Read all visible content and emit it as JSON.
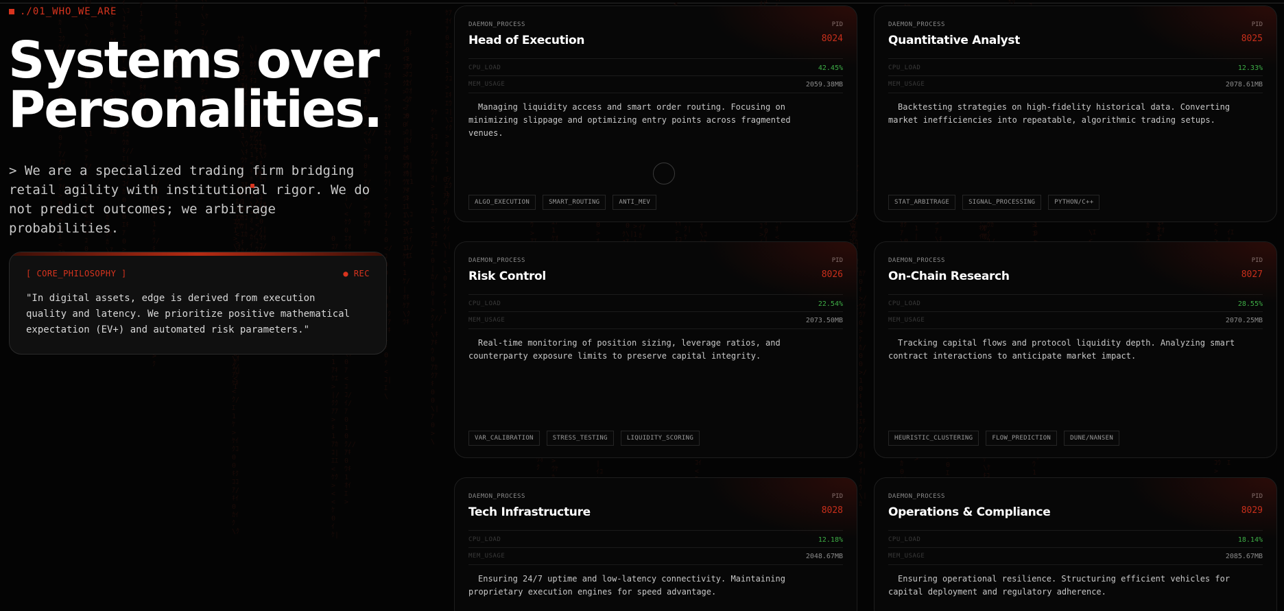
{
  "section_tag": "./01_WHO_WE_ARE",
  "hero": {
    "title_line1": "Systems over",
    "title_line2": "Personalities.",
    "subtitle": "> We are a specialized trading firm bridging retail agility with institutional rigor. We do not predict outcomes; we arbitrage probabilities."
  },
  "philosophy": {
    "label": "[ CORE_PHILOSOPHY ]",
    "status": "● REC",
    "quote": "\"In digital assets, edge is derived from execution quality and latency. We prioritize positive mathematical expectation (EV+) and automated risk parameters.\""
  },
  "common": {
    "process_label": "DAEMON_PROCESS",
    "pid_label": "PID",
    "cpu_label": "CPU_LOAD",
    "mem_label": "MEM_USAGE"
  },
  "colors": {
    "accent": "#d9341e",
    "cpu_green": "#3fae46",
    "background": "#040404"
  },
  "cards": [
    {
      "title": "Head of Execution",
      "pid": "8024",
      "cpu": "42.45%",
      "mem": "2059.38MB",
      "description": "Managing liquidity access and smart order routing. Focusing on minimizing slippage and optimizing entry points across fragmented venues.",
      "tags": [
        "ALGO_EXECUTION",
        "SMART_ROUTING",
        "ANTI_MEV"
      ]
    },
    {
      "title": "Quantitative Analyst",
      "pid": "8025",
      "cpu": "12.33%",
      "mem": "2078.61MB",
      "description": "Backtesting strategies on high-fidelity historical data. Converting market inefficiencies into repeatable, algorithmic trading setups.",
      "tags": [
        "STAT_ARBITRAGE",
        "SIGNAL_PROCESSING",
        "PYTHON/C++"
      ]
    },
    {
      "title": "Risk Control",
      "pid": "8026",
      "cpu": "22.54%",
      "mem": "2073.50MB",
      "description": "Real-time monitoring of position sizing, leverage ratios, and counterparty exposure limits to preserve capital integrity.",
      "tags": [
        "VAR_CALIBRATION",
        "STRESS_TESTING",
        "LIQUIDITY_SCORING"
      ]
    },
    {
      "title": "On-Chain Research",
      "pid": "8027",
      "cpu": "28.55%",
      "mem": "2070.25MB",
      "description": "Tracking capital flows and protocol liquidity depth. Analyzing smart contract interactions to anticipate market impact.",
      "tags": [
        "HEURISTIC_CLUSTERING",
        "FLOW_PREDICTION",
        "DUNE/NANSEN"
      ]
    },
    {
      "title": "Tech Infrastructure",
      "pid": "8028",
      "cpu": "12.18%",
      "mem": "2048.67MB",
      "description": "Ensuring 24/7 uptime and low-latency connectivity. Maintaining proprietary execution engines for speed advantage.",
      "tags": []
    },
    {
      "title": "Operations & Compliance",
      "pid": "8029",
      "cpu": "18.14%",
      "mem": "2085.67MB",
      "description": "Ensuring operational resilience. Structuring efficient vehicles for capital deployment and regulatory adherence.",
      "tags": []
    }
  ]
}
